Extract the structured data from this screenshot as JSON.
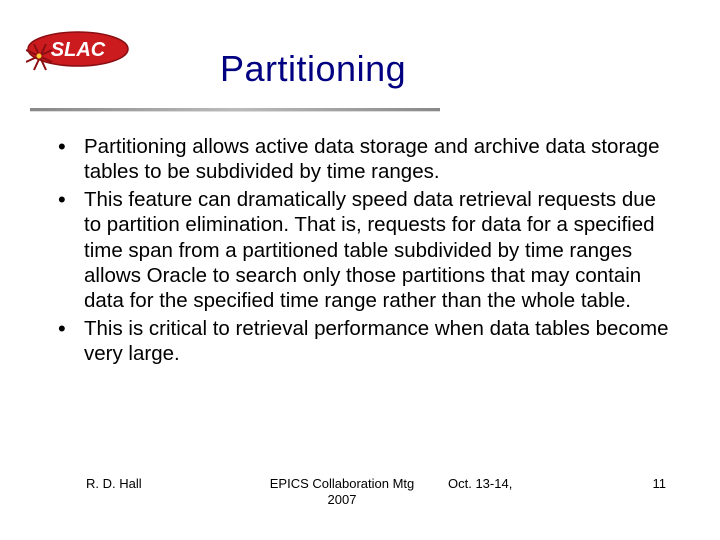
{
  "colors": {
    "title": "#000080",
    "logo_red": "#cc1b1f",
    "logo_outline": "#8a0e12"
  },
  "logo": {
    "text": "SLAC"
  },
  "title": "Partitioning",
  "bullets": [
    "Partitioning allows active data storage and archive data storage tables to be subdivided by time ranges.",
    "This feature can dramatically speed data retrieval requests due to partition elimination.  That is, requests for data for a specified time span from a partitioned table subdivided by time ranges allows Oracle to search only those partitions that may contain data for the specified time range rather than the whole table.",
    "This is critical to retrieval performance when data tables become very large."
  ],
  "footer": {
    "author": "R. D. Hall",
    "event_line1": "EPICS Collaboration Mtg",
    "event_line2": "2007",
    "date": "Oct. 13-14,",
    "page": "11"
  }
}
